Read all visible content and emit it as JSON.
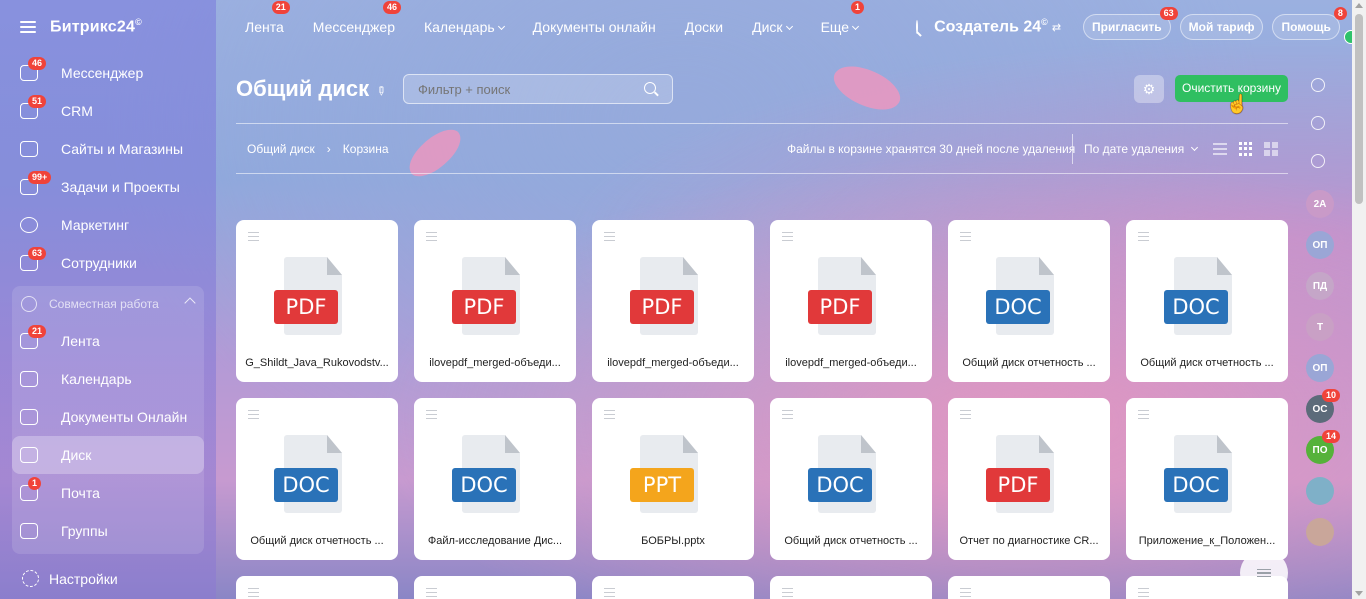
{
  "app": {
    "logo": "Битрикс24",
    "logo_mark": "©",
    "company": "Создатель 24",
    "company_mark": "©"
  },
  "topnav": [
    {
      "label": "Лента",
      "badge": "21",
      "dropdown": false
    },
    {
      "label": "Мессенджер",
      "badge": "46",
      "dropdown": false
    },
    {
      "label": "Календарь",
      "badge": "",
      "dropdown": true
    },
    {
      "label": "Документы онлайн",
      "badge": "",
      "dropdown": false
    },
    {
      "label": "Доски",
      "badge": "",
      "dropdown": false
    },
    {
      "label": "Диск",
      "badge": "",
      "dropdown": true
    },
    {
      "label": "Еще",
      "badge": "1",
      "dropdown": true
    }
  ],
  "top_actions": {
    "invite": "Пригласить",
    "invite_badge": "63",
    "tariff": "Мой тариф",
    "help": "Помощь",
    "help_badge": "8"
  },
  "sidebar": {
    "items": [
      {
        "label": "Мессенджер",
        "badge": "46",
        "icon": "chat-icon"
      },
      {
        "label": "CRM",
        "badge": "51",
        "icon": "crm-icon"
      },
      {
        "label": "Сайты и Магазины",
        "badge": "",
        "icon": "cart-icon"
      },
      {
        "label": "Задачи и Проекты",
        "badge": "99+",
        "icon": "tasks-icon"
      },
      {
        "label": "Маркетинг",
        "badge": "",
        "icon": "marketing-icon"
      },
      {
        "label": "Сотрудники",
        "badge": "63",
        "icon": "people-icon"
      }
    ],
    "group": {
      "title": "Совместная работа",
      "items": [
        {
          "label": "Лента",
          "badge": "21",
          "icon": "feed-icon"
        },
        {
          "label": "Календарь",
          "badge": "",
          "icon": "calendar-icon"
        },
        {
          "label": "Документы Онлайн",
          "badge": "",
          "icon": "document-icon"
        },
        {
          "label": "Диск",
          "badge": "",
          "icon": "disk-icon",
          "active": true
        },
        {
          "label": "Почта",
          "badge": "1",
          "icon": "mail-icon"
        },
        {
          "label": "Группы",
          "badge": "",
          "icon": "groups-icon"
        }
      ]
    },
    "settings": "Настройки"
  },
  "page": {
    "title": "Общий диск",
    "filter_placeholder": "Фильтр + поиск",
    "clear_button": "Очистить корзину",
    "breadcrumb": [
      "Общий диск",
      "Корзина"
    ],
    "info": "Файлы в корзине хранятся 30 дней после удаления",
    "sort": "По дате удаления"
  },
  "files": [
    {
      "type": "PDF",
      "name": "G_Shildt_Java_Rukovodstv..."
    },
    {
      "type": "PDF",
      "name": "ilovepdf_merged-объеди..."
    },
    {
      "type": "PDF",
      "name": "ilovepdf_merged-объеди..."
    },
    {
      "type": "PDF",
      "name": "ilovepdf_merged-объеди..."
    },
    {
      "type": "DOC",
      "name": "Общий диск отчетность ..."
    },
    {
      "type": "DOC",
      "name": "Общий диск отчетность ..."
    },
    {
      "type": "DOC",
      "name": "Общий диск отчетность ..."
    },
    {
      "type": "DOC",
      "name": "Файл-исследование Дис..."
    },
    {
      "type": "PPT",
      "name": "БОБРЫ.pptx"
    },
    {
      "type": "DOC",
      "name": "Общий диск отчетность ..."
    },
    {
      "type": "PDF",
      "name": "Отчет по диагностике CR..."
    },
    {
      "type": "DOC",
      "name": "Приложение_к_Положен..."
    }
  ],
  "rail_avatars": [
    {
      "initials": "2А",
      "color": "#c99ac8",
      "badge": ""
    },
    {
      "initials": "ОП",
      "color": "#9aa6d6",
      "badge": ""
    },
    {
      "initials": "ПД",
      "color": "#c5a6c8",
      "badge": ""
    },
    {
      "initials": "Т",
      "color": "#c9a0c5",
      "badge": ""
    },
    {
      "initials": "ОП",
      "color": "#9aa6d6",
      "badge": ""
    },
    {
      "initials": "ОС",
      "color": "#5c6b7a",
      "badge": "10"
    },
    {
      "initials": "ПО",
      "color": "#55b23a",
      "badge": "14"
    }
  ]
}
